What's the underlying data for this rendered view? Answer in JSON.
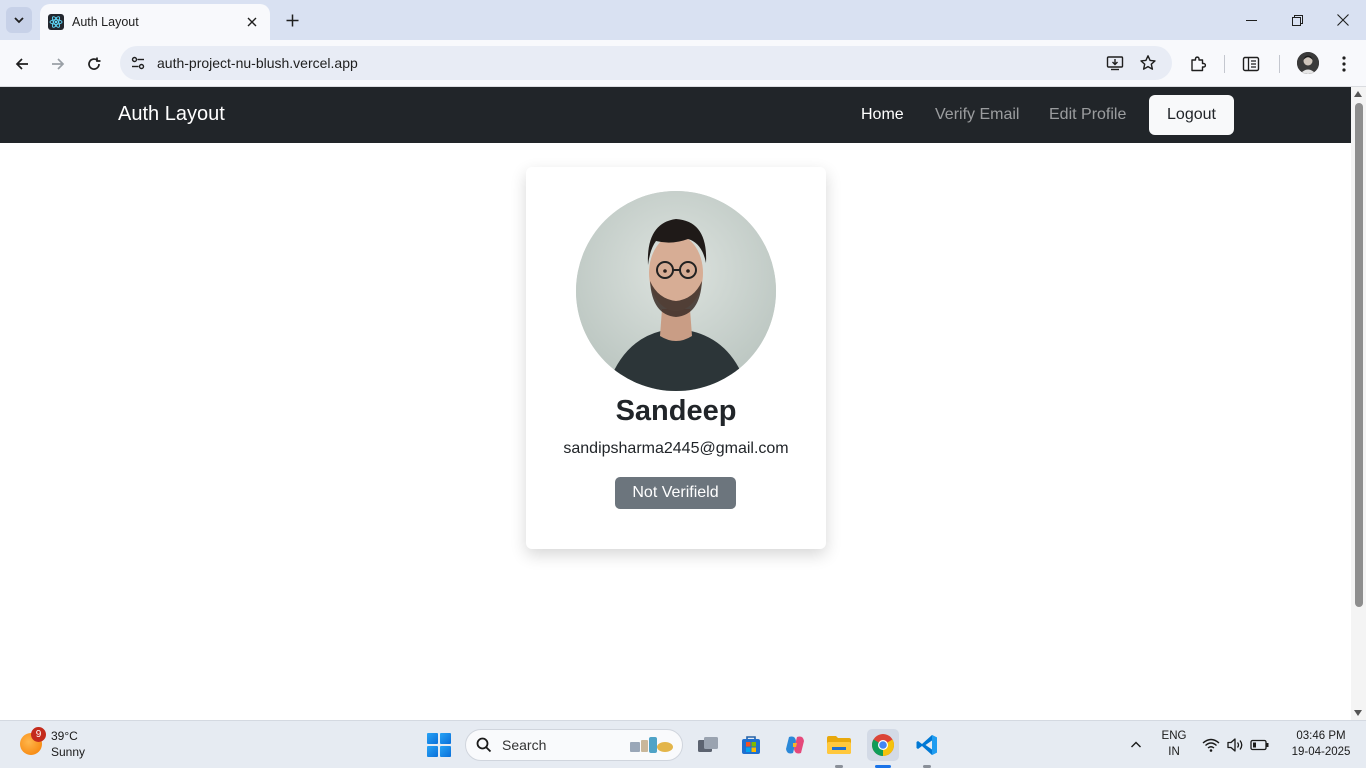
{
  "browser": {
    "tab_title": "Auth Layout",
    "url": "auth-project-nu-blush.vercel.app"
  },
  "site": {
    "brand": "Auth Layout",
    "nav": {
      "home": "Home",
      "verify_email": "Verify Email",
      "edit_profile": "Edit Profile"
    },
    "logout_label": "Logout"
  },
  "profile_card": {
    "name": "Sandeep",
    "email": "sandipsharma2445@gmail.com",
    "status_badge": "Not Verifield"
  },
  "taskbar": {
    "weather_badge": "9",
    "temperature": "39°C",
    "condition": "Sunny",
    "search_placeholder": "Search",
    "language": "ENG",
    "region": "IN",
    "time": "03:46 PM",
    "date": "19-04-2025"
  },
  "colors": {
    "navbar_bg": "#212529",
    "badge_bg": "#6c757d",
    "tabstrip_bg": "#d9e1f2"
  }
}
